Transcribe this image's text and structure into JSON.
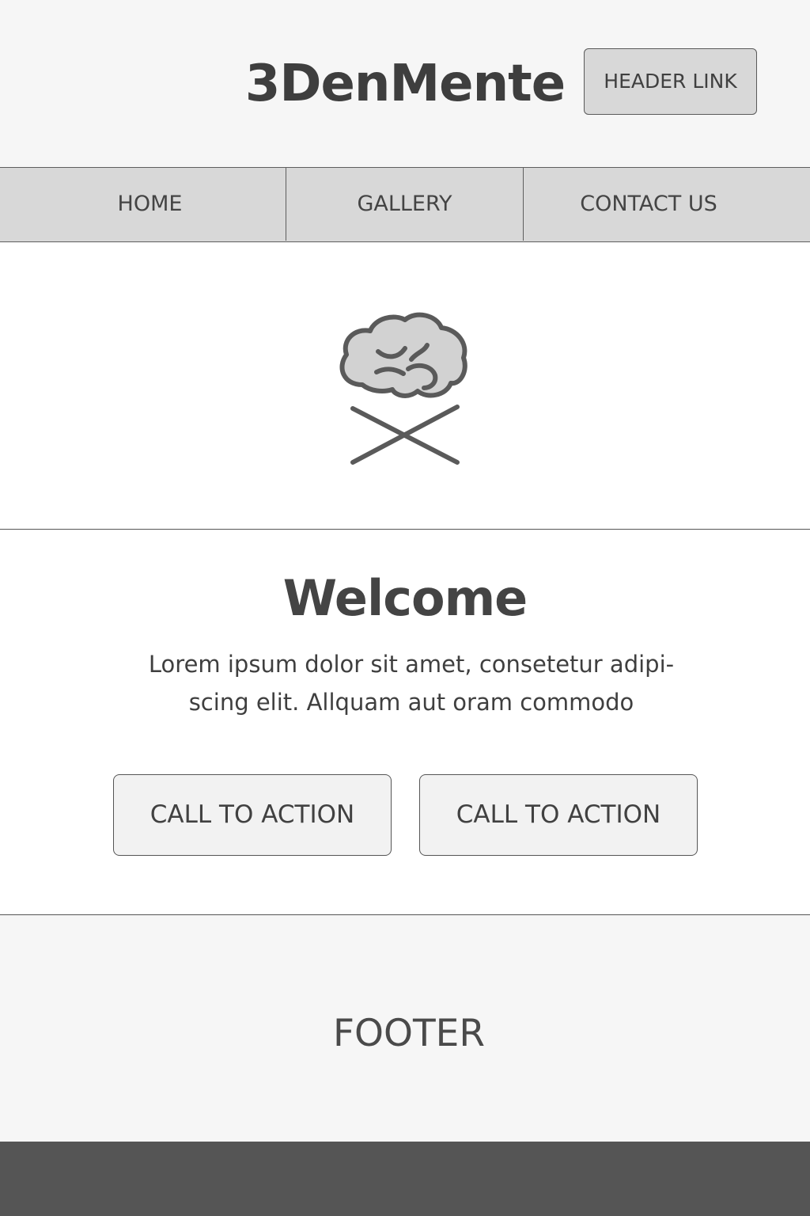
{
  "header": {
    "title": "3DenMente",
    "link_label": "HEADER LINK"
  },
  "nav": {
    "items": [
      {
        "label": "HOME"
      },
      {
        "label": "GALLERY"
      },
      {
        "label": "CONTACT US"
      }
    ]
  },
  "hero": {
    "logo_icon": "brain-crossbones-icon"
  },
  "main": {
    "title": "Welcome",
    "text": "Lorem ipsum dolor sit amet, consetetur adipi-scing elit. Allquam aut oram commodo",
    "text_line1": "Lorem ipsum dolor sit amet, consetetur adipi-",
    "text_line2": "scing elit. Allquam aut oram commodo",
    "cta_primary": "CALL TO ACTION",
    "cta_secondary": "CALL TO ACTION"
  },
  "footer": {
    "label": "FOOTER"
  },
  "colors": {
    "header_bg": "#f6f6f6",
    "nav_bg": "#d8d8d8",
    "button_bg": "#f2f2f2",
    "text": "#444444",
    "bottom_bar": "#555555"
  }
}
